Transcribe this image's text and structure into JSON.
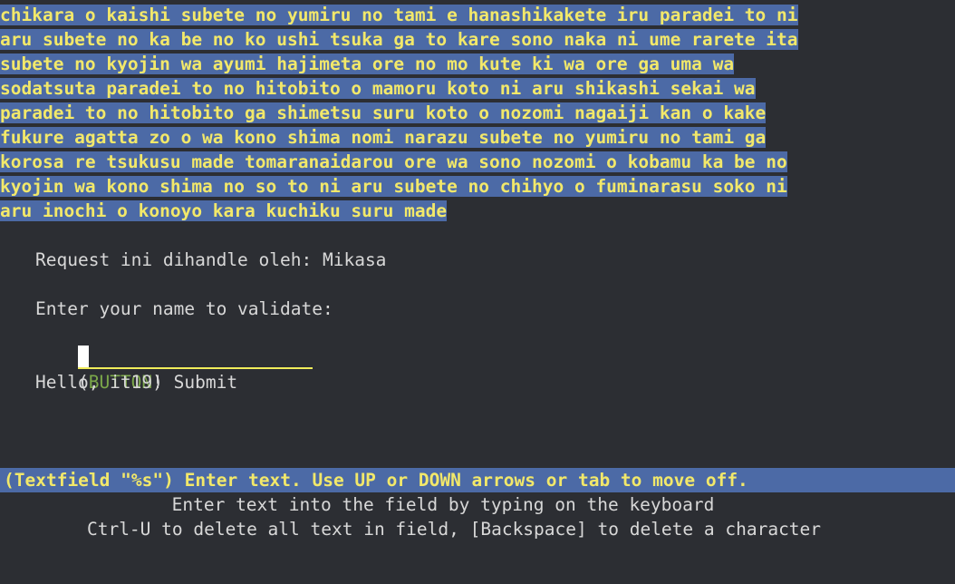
{
  "lyrics": {
    "lines": [
      "chikara o kaishi subete no yumiru no tami e hanashikakete iru paradei to ni",
      "aru subete no ka be no ko ushi tsuka ga to kare sono naka ni ume rarete ita",
      "subete no kyojin wa ayumi hajimeta ore no mo kute ki wa ore ga uma wa",
      "sodatsuta paradei to no hitobito o mamoru koto ni aru shikashi sekai wa",
      "paradei to no hitobito ga shimetsu suru koto o nozomi nagaiji kan o kake",
      "fukure agatta zo o wa kono shima nomi narazu subete no yumiru no tami ga",
      "korosa re tsukusu made tomaranaidarou ore wa sono nozomi o kobamu ka be no",
      "kyojin wa kono shima no so to ni aru subete no chihyo o fuminarasu soko ni",
      "aru inochi o konoyo kara kuchiku suru made"
    ]
  },
  "request": {
    "handled_by": "Request ini dihandle oleh: Mikasa"
  },
  "form": {
    "prompt": "Enter your name to validate:",
    "name_value": "",
    "button_open": "(",
    "button_word": "BUTTON",
    "button_close": ")",
    "submit_label": "Submit"
  },
  "greeting": "Hello, it19!",
  "help": {
    "status": "(Textfield \"%s\") Enter text. Use UP or DOWN arrows or tab to move off.",
    "line1": "Enter text into the field by typing on the keyboard",
    "line2": "Ctrl-U to delete all text in field, [Backspace] to delete a character"
  }
}
